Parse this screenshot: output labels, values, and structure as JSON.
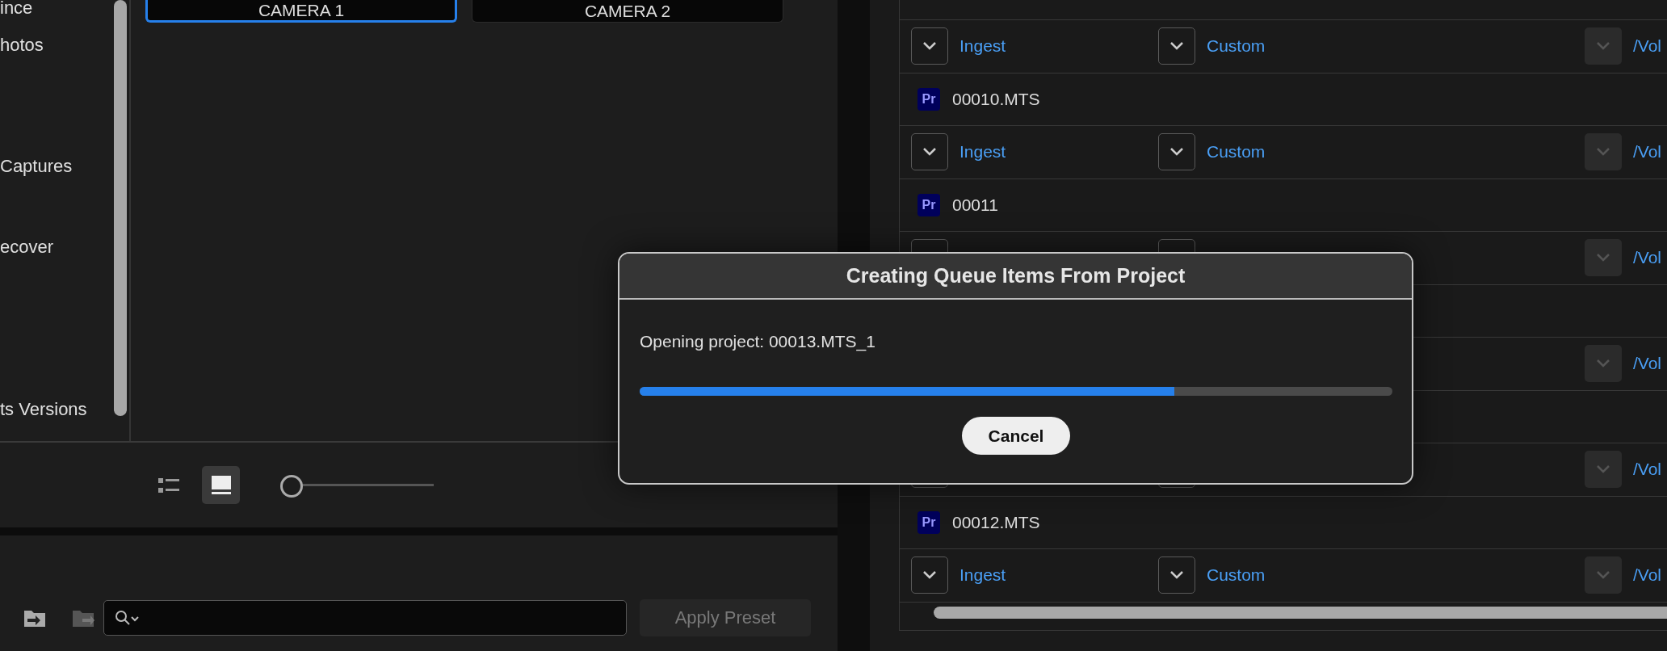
{
  "sidebar": {
    "items": [
      {
        "label": "ince"
      },
      {
        "label": "hotos"
      },
      {
        "label": "Captures"
      },
      {
        "label": "ecover"
      },
      {
        "label": "ts Versions"
      }
    ]
  },
  "cameras": [
    {
      "label": "CAMERA 1",
      "selected": true
    },
    {
      "label": "CAMERA 2",
      "selected": false
    }
  ],
  "view_toolbar": {
    "view_buttons": [
      {
        "kind": "list",
        "selected": false
      },
      {
        "kind": "thumbnail",
        "selected": true
      }
    ],
    "zoom": {
      "level": 0
    }
  },
  "preset_bar": {
    "apply_button": {
      "label": "Apply Preset",
      "disabled": true
    }
  },
  "queue": {
    "rows": [
      {
        "kind": "settings",
        "format": "Ingest",
        "preset": "Custom",
        "output": "/Vol",
        "output_disabled": true
      },
      {
        "kind": "file",
        "badge": "Pr",
        "name": "00010.MTS"
      },
      {
        "kind": "settings",
        "format": "Ingest",
        "preset": "Custom",
        "output": "/Vol",
        "output_disabled": true
      },
      {
        "kind": "file",
        "badge": "Pr",
        "name": "00011"
      },
      {
        "kind": "settings",
        "dropdowns_shown": true,
        "output": "/Vol",
        "output_disabled": true
      },
      {
        "kind": "file"
      },
      {
        "kind": "settings",
        "dropdowns_shown": false,
        "output": "/Vol",
        "output_disabled": true
      },
      {
        "kind": "file"
      },
      {
        "kind": "settings",
        "dropdowns_shown": true,
        "output": "/Vol",
        "output_disabled": true
      },
      {
        "kind": "file",
        "badge": "Pr",
        "name": "00012.MTS"
      },
      {
        "kind": "settings",
        "format": "Ingest",
        "preset": "Custom",
        "output": "/Vol",
        "output_disabled": true
      }
    ]
  },
  "dialog": {
    "title": "Creating Queue Items From Project",
    "message": "Opening project: 00013.MTS_1",
    "progress": {
      "level": 0.71
    },
    "button": "Cancel"
  }
}
